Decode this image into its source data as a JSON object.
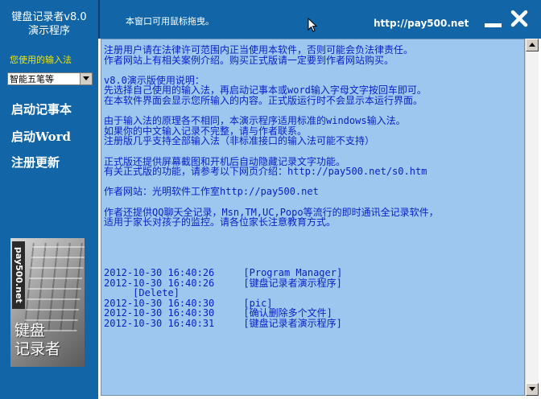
{
  "sidebar": {
    "title_line1": "键盘记录者v8.0",
    "title_line2": "演示程序",
    "ime_label": "您使用的输入法",
    "ime_selected": "智能五笔等",
    "menu": [
      "启动记事本",
      "启动Word",
      "注册更新"
    ],
    "logo_vertical_text": "pay500.net",
    "logo_line1": "键盘",
    "logo_line2": "记录者"
  },
  "header": {
    "drag_hint": "本窗口可用鼠标拖曳。",
    "url": "http://pay500.net"
  },
  "content": {
    "text": "注册用户请在法律许可范围内正当使用本软件，否则可能会负法律责任。\n作者网站上有相关案例介绍。购买正式版请一定要到作者网站购买。\n\nv8.0演示版使用说明：\n先选择自己使用的输入法，再启动记事本或word输入字母文字按回车即可。\n在本软件界面会显示您所输入的内容。正式版运行时不会显示本运行界面。\n\n由于输入法的原理各不相同，本演示程序适用标准的windows输入法。\n如果你的中文输入记录不完整，请与作者联系。\n注册版几乎支持全部输入法（非标准接口的输入法可能不支持）\n\n正式版还提供屏幕截图和开机后自动隐藏记录文字功能。\n有关正式版的功能，请参考以下网页介绍：http://pay500.net/s0.htm\n\n作者网站：光明软件工作室http://pay500.net\n\n作者还提供QQ聊天全记录，Msn,TM,UC,Popo等流行的即时通讯全记录软件，\n适用于家长对孩子的监控。请各位家长注意教育方式。\n\n\n\n\n2012-10-30 16:40:26     [Program Manager]\n2012-10-30 16:40:26     [键盘记录者演示程序]\n     [Delete]\n2012-10-30 16:40:30     [pic]\n2012-10-30 16:40:30     [确认删除多个文件]\n2012-10-30 16:40:31     [键盘记录者演示程序]"
  },
  "colors": {
    "chrome_blue": "#1265a6",
    "content_bg": "#9dc7ef",
    "text_blue": "#0a1fc8",
    "label_yellow": "#f2e600"
  }
}
